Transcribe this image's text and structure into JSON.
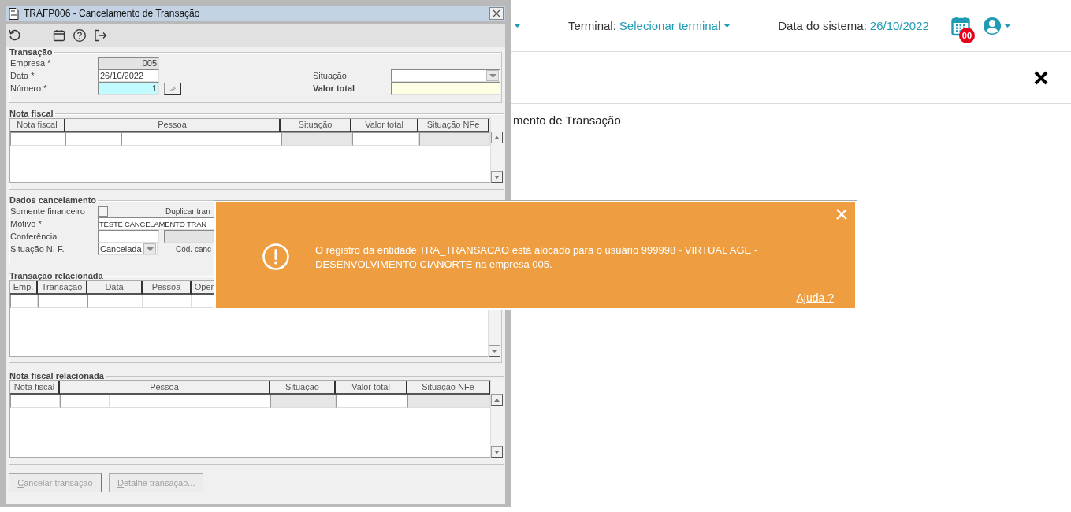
{
  "header": {
    "terminal_label": "Terminal:",
    "terminal_value": "Selecionar terminal",
    "date_label": "Data do sistema:",
    "date_value": "26/10/2022",
    "notification_count": "00"
  },
  "page": {
    "title_fragment": "mento de Transação"
  },
  "window": {
    "title": "TRAFP006 - Cancelamento de Transação"
  },
  "toolbar": [
    {
      "kind": "refresh"
    },
    {
      "kind": "calendar"
    },
    {
      "kind": "help"
    },
    {
      "kind": "exit"
    }
  ],
  "transacao": {
    "legend": "Transação",
    "empresa": {
      "label": "Empresa *",
      "value": "005"
    },
    "data": {
      "label": "Data *",
      "value": "26/10/2022"
    },
    "numero": {
      "label": "Número *",
      "value": "1"
    },
    "situacao": {
      "label": "Situação"
    },
    "valor_total": {
      "label": "Valor total"
    }
  },
  "nota_fiscal": {
    "legend": "Nota fiscal",
    "columns": [
      "Nota fiscal",
      "Pessoa",
      "Situação",
      "Valor total",
      "Situação NFe"
    ],
    "row_cells": [
      {
        "disabled": false
      },
      {
        "disabled": false
      },
      {
        "disabled": false
      },
      {
        "disabled": true
      },
      {
        "disabled": false
      },
      {
        "disabled": true
      }
    ]
  },
  "dados_cancelamento": {
    "legend": "Dados cancelamento",
    "somente_financeiro": {
      "label": "Somente financeiro",
      "checked": false
    },
    "duplicar": {
      "label": "Duplicar tran"
    },
    "motivo": {
      "label": "Motivo *",
      "value": "TESTE CANCELAMENTO TRAN"
    },
    "conferencia": {
      "label": "Conferência"
    },
    "situacao_nf": {
      "label": "Situação N. F.",
      "value": "Cancelada"
    },
    "cod_canc": {
      "label": "Cód. canc"
    }
  },
  "transacao_relacionada": {
    "legend": "Transação relacionada",
    "columns": [
      "Emp.",
      "Transação",
      "Data",
      "Pessoa",
      "Oper"
    ],
    "row_cells": [
      {
        "disabled": false
      },
      {
        "disabled": false
      },
      {
        "disabled": false
      },
      {
        "disabled": false
      },
      {
        "disabled": false
      }
    ]
  },
  "nota_fiscal_relacionada": {
    "legend": "Nota fiscal relacionada",
    "columns": [
      "Nota fiscal",
      "Pessoa",
      "Situação",
      "Valor total",
      "Situação NFe"
    ],
    "row_cells": [
      {
        "disabled": false
      },
      {
        "disabled": false
      },
      {
        "disabled": false
      },
      {
        "disabled": true
      },
      {
        "disabled": false
      },
      {
        "disabled": true
      }
    ]
  },
  "buttons": [
    {
      "label": "Cancelar transação",
      "disabled": true
    },
    {
      "label": "Detalhe transação...",
      "disabled": true
    }
  ],
  "toast": {
    "message": "O registro da entidade TRA_TRANSACAO está alocado para o usuário 999998 - VIRTUAL AGE - DESENVOLVIMENTO CIANORTE na empresa 005.",
    "help_link": "Ajuda ?"
  }
}
